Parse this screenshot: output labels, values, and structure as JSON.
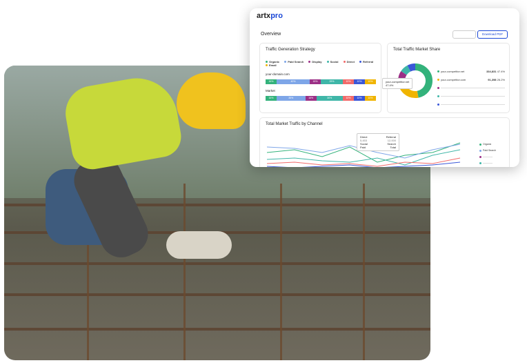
{
  "brand": {
    "logo_main": "artx",
    "logo_accent": "pro"
  },
  "overview": {
    "title": "Overview",
    "download_label": "Download PDF"
  },
  "traffic_generation": {
    "title": "Traffic Generation Strategy",
    "legend": [
      "Organic",
      "Paid Search",
      "Display",
      "Social",
      "Direct",
      "Referral",
      "Email"
    ],
    "colors": [
      "#33b27b",
      "#7ea6e8",
      "#9b2f86",
      "#3fb6a8",
      "#f26a6a",
      "#3a57d8",
      "#f0b400"
    ],
    "rows": [
      {
        "label": "your-domain.com",
        "values": [
          "16%",
          "40%",
          "15%",
          "29%",
          "10%",
          "10%",
          "10%"
        ]
      },
      {
        "label": "Market",
        "values": [
          "16%",
          "35%",
          "16%",
          "30%",
          "10%",
          "10%",
          "10%"
        ]
      }
    ]
  },
  "market_share": {
    "title": "Total Traffic Market Share",
    "tooltip": {
      "name": "your-competitor.net",
      "value": "47.4%"
    },
    "list": [
      {
        "name": "your-competitor.net",
        "value": "334,831",
        "pct": "47.4%",
        "color": "#33b27b"
      },
      {
        "name": "your-competitor.com",
        "value": "91,398",
        "pct": "26.2%",
        "color": "#f0b400"
      },
      {
        "name": "",
        "value": "",
        "pct": "",
        "color": "#9b2f86"
      },
      {
        "name": "",
        "value": "",
        "pct": "",
        "color": "#3fb6a8"
      },
      {
        "name": "",
        "value": "",
        "pct": "",
        "color": "#3a57d8"
      }
    ]
  },
  "channel": {
    "title": "Total Market Traffic by Channel",
    "tooltip": {
      "direct": "Direct",
      "direct_val": "5,453",
      "referral": "Referral",
      "referral_val": "12,000",
      "social": "Social",
      "search": "Search",
      "paid": "Paid",
      "total": "Total"
    },
    "legend": [
      "Organic",
      "Paid Search",
      "",
      "",
      "",
      "",
      ""
    ]
  }
}
